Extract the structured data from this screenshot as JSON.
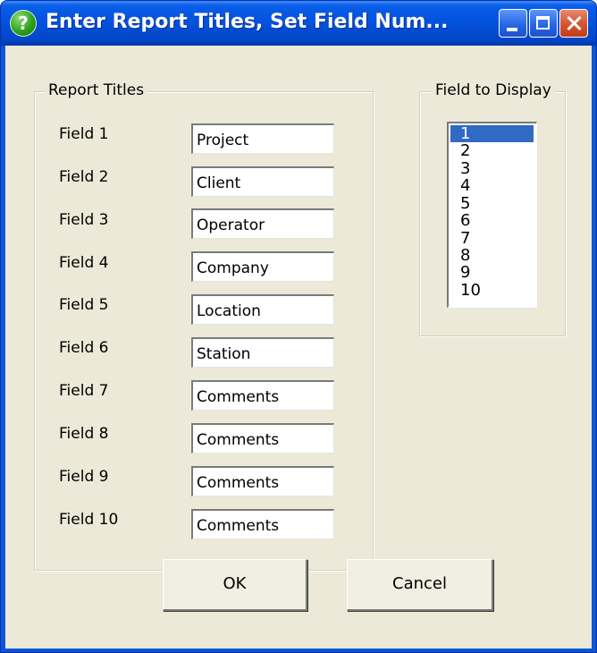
{
  "window": {
    "title": "Enter Report Titles, Set Field Num...",
    "help_glyph": "?"
  },
  "report_titles": {
    "group_label": "Report Titles",
    "fields": [
      {
        "label": "Field 1",
        "value": "Project"
      },
      {
        "label": "Field 2",
        "value": "Client"
      },
      {
        "label": "Field 3",
        "value": "Operator"
      },
      {
        "label": "Field 4",
        "value": "Company"
      },
      {
        "label": "Field 5",
        "value": "Location"
      },
      {
        "label": "Field 6",
        "value": "Station"
      },
      {
        "label": "Field 7",
        "value": "Comments"
      },
      {
        "label": "Field 8",
        "value": "Comments"
      },
      {
        "label": "Field 9",
        "value": "Comments"
      },
      {
        "label": "Field 10",
        "value": "Comments"
      }
    ]
  },
  "field_to_display": {
    "group_label": "Field to Display",
    "options": [
      "1",
      "2",
      "3",
      "4",
      "5",
      "6",
      "7",
      "8",
      "9",
      "10"
    ],
    "selected": "1"
  },
  "buttons": {
    "ok": "OK",
    "cancel": "Cancel"
  },
  "colors": {
    "titlebar": "#0454e0",
    "dialog_face": "#ece9d8",
    "selection": "#316ac5"
  }
}
